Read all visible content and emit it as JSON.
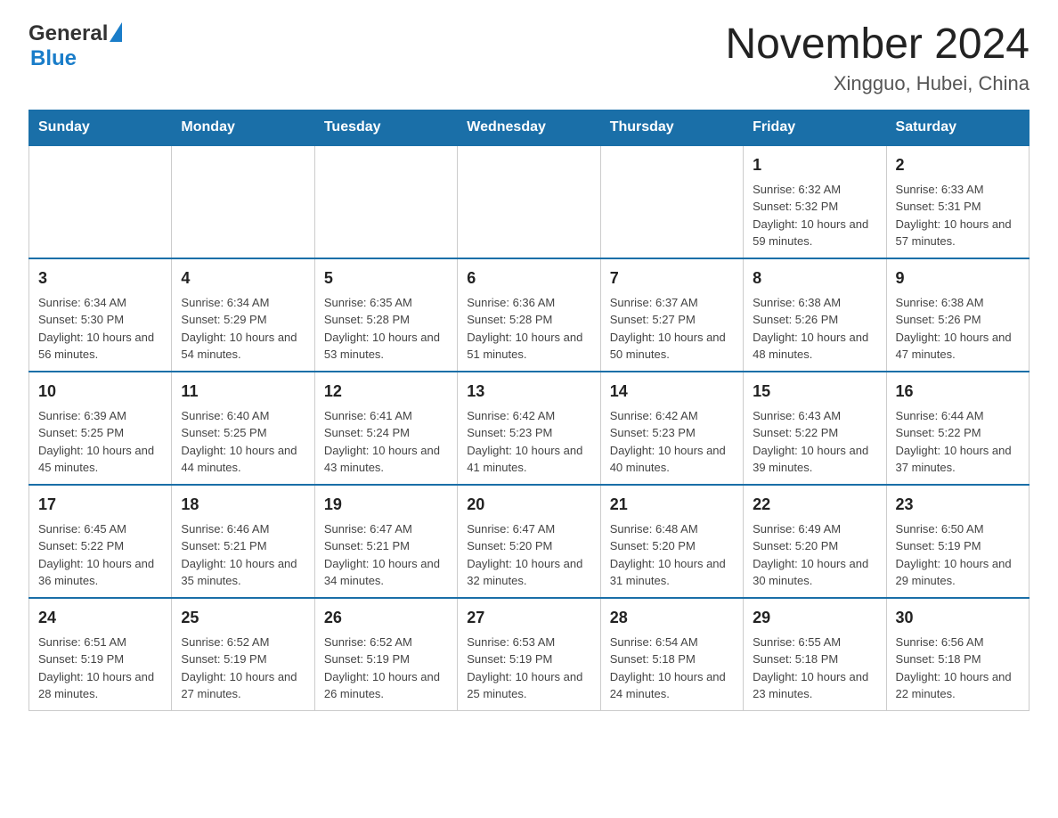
{
  "header": {
    "logo_general": "General",
    "logo_blue": "Blue",
    "month_title": "November 2024",
    "location": "Xingguo, Hubei, China"
  },
  "days_of_week": [
    "Sunday",
    "Monday",
    "Tuesday",
    "Wednesday",
    "Thursday",
    "Friday",
    "Saturday"
  ],
  "weeks": [
    [
      {
        "day": "",
        "info": ""
      },
      {
        "day": "",
        "info": ""
      },
      {
        "day": "",
        "info": ""
      },
      {
        "day": "",
        "info": ""
      },
      {
        "day": "",
        "info": ""
      },
      {
        "day": "1",
        "info": "Sunrise: 6:32 AM\nSunset: 5:32 PM\nDaylight: 10 hours and 59 minutes."
      },
      {
        "day": "2",
        "info": "Sunrise: 6:33 AM\nSunset: 5:31 PM\nDaylight: 10 hours and 57 minutes."
      }
    ],
    [
      {
        "day": "3",
        "info": "Sunrise: 6:34 AM\nSunset: 5:30 PM\nDaylight: 10 hours and 56 minutes."
      },
      {
        "day": "4",
        "info": "Sunrise: 6:34 AM\nSunset: 5:29 PM\nDaylight: 10 hours and 54 minutes."
      },
      {
        "day": "5",
        "info": "Sunrise: 6:35 AM\nSunset: 5:28 PM\nDaylight: 10 hours and 53 minutes."
      },
      {
        "day": "6",
        "info": "Sunrise: 6:36 AM\nSunset: 5:28 PM\nDaylight: 10 hours and 51 minutes."
      },
      {
        "day": "7",
        "info": "Sunrise: 6:37 AM\nSunset: 5:27 PM\nDaylight: 10 hours and 50 minutes."
      },
      {
        "day": "8",
        "info": "Sunrise: 6:38 AM\nSunset: 5:26 PM\nDaylight: 10 hours and 48 minutes."
      },
      {
        "day": "9",
        "info": "Sunrise: 6:38 AM\nSunset: 5:26 PM\nDaylight: 10 hours and 47 minutes."
      }
    ],
    [
      {
        "day": "10",
        "info": "Sunrise: 6:39 AM\nSunset: 5:25 PM\nDaylight: 10 hours and 45 minutes."
      },
      {
        "day": "11",
        "info": "Sunrise: 6:40 AM\nSunset: 5:25 PM\nDaylight: 10 hours and 44 minutes."
      },
      {
        "day": "12",
        "info": "Sunrise: 6:41 AM\nSunset: 5:24 PM\nDaylight: 10 hours and 43 minutes."
      },
      {
        "day": "13",
        "info": "Sunrise: 6:42 AM\nSunset: 5:23 PM\nDaylight: 10 hours and 41 minutes."
      },
      {
        "day": "14",
        "info": "Sunrise: 6:42 AM\nSunset: 5:23 PM\nDaylight: 10 hours and 40 minutes."
      },
      {
        "day": "15",
        "info": "Sunrise: 6:43 AM\nSunset: 5:22 PM\nDaylight: 10 hours and 39 minutes."
      },
      {
        "day": "16",
        "info": "Sunrise: 6:44 AM\nSunset: 5:22 PM\nDaylight: 10 hours and 37 minutes."
      }
    ],
    [
      {
        "day": "17",
        "info": "Sunrise: 6:45 AM\nSunset: 5:22 PM\nDaylight: 10 hours and 36 minutes."
      },
      {
        "day": "18",
        "info": "Sunrise: 6:46 AM\nSunset: 5:21 PM\nDaylight: 10 hours and 35 minutes."
      },
      {
        "day": "19",
        "info": "Sunrise: 6:47 AM\nSunset: 5:21 PM\nDaylight: 10 hours and 34 minutes."
      },
      {
        "day": "20",
        "info": "Sunrise: 6:47 AM\nSunset: 5:20 PM\nDaylight: 10 hours and 32 minutes."
      },
      {
        "day": "21",
        "info": "Sunrise: 6:48 AM\nSunset: 5:20 PM\nDaylight: 10 hours and 31 minutes."
      },
      {
        "day": "22",
        "info": "Sunrise: 6:49 AM\nSunset: 5:20 PM\nDaylight: 10 hours and 30 minutes."
      },
      {
        "day": "23",
        "info": "Sunrise: 6:50 AM\nSunset: 5:19 PM\nDaylight: 10 hours and 29 minutes."
      }
    ],
    [
      {
        "day": "24",
        "info": "Sunrise: 6:51 AM\nSunset: 5:19 PM\nDaylight: 10 hours and 28 minutes."
      },
      {
        "day": "25",
        "info": "Sunrise: 6:52 AM\nSunset: 5:19 PM\nDaylight: 10 hours and 27 minutes."
      },
      {
        "day": "26",
        "info": "Sunrise: 6:52 AM\nSunset: 5:19 PM\nDaylight: 10 hours and 26 minutes."
      },
      {
        "day": "27",
        "info": "Sunrise: 6:53 AM\nSunset: 5:19 PM\nDaylight: 10 hours and 25 minutes."
      },
      {
        "day": "28",
        "info": "Sunrise: 6:54 AM\nSunset: 5:18 PM\nDaylight: 10 hours and 24 minutes."
      },
      {
        "day": "29",
        "info": "Sunrise: 6:55 AM\nSunset: 5:18 PM\nDaylight: 10 hours and 23 minutes."
      },
      {
        "day": "30",
        "info": "Sunrise: 6:56 AM\nSunset: 5:18 PM\nDaylight: 10 hours and 22 minutes."
      }
    ]
  ]
}
